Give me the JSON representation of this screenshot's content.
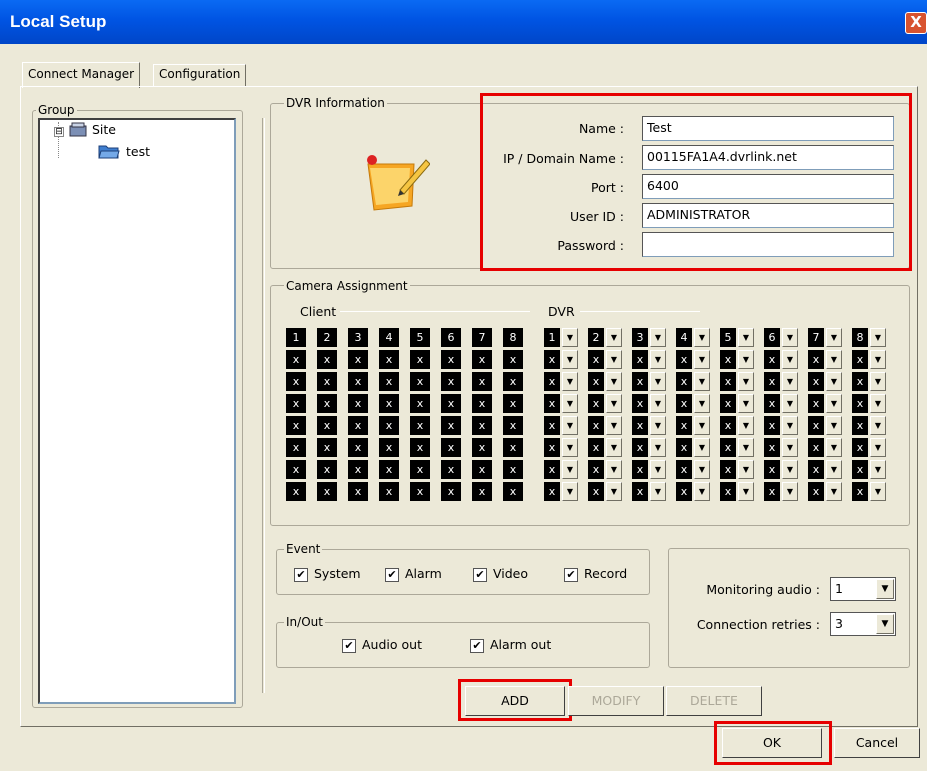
{
  "window": {
    "title": "Local Setup",
    "close_glyph": "X"
  },
  "tabs": [
    {
      "label": "Connect Manager"
    },
    {
      "label": "Configuration"
    }
  ],
  "group": {
    "label": "Group",
    "tree": [
      {
        "label": "Site",
        "expander": "⊟",
        "icon": "folder-icon"
      },
      {
        "label": "test",
        "icon": "folder-icon"
      }
    ]
  },
  "dvr_info": {
    "label": "DVR Information",
    "fields": [
      {
        "label": "Name :",
        "value": "Test"
      },
      {
        "label": "IP / Domain Name :",
        "value": "00115FA1A4.dvrlink.net"
      },
      {
        "label": "Port :",
        "value": "6400"
      },
      {
        "label": "User ID :",
        "value": "ADMINISTRATOR"
      },
      {
        "label": "Password :",
        "value": ""
      }
    ]
  },
  "camera": {
    "label": "Camera Assignment",
    "client_label": "Client",
    "dvr_label": "DVR",
    "headers": [
      "1",
      "2",
      "3",
      "4",
      "5",
      "6",
      "7",
      "8"
    ],
    "cell_mark": "x",
    "row_count": 7
  },
  "event": {
    "label": "Event",
    "items": [
      {
        "label": "System",
        "checked": true
      },
      {
        "label": "Alarm",
        "checked": true
      },
      {
        "label": "Video",
        "checked": true
      },
      {
        "label": "Record",
        "checked": true
      }
    ]
  },
  "inout": {
    "label": "In/Out",
    "items": [
      {
        "label": "Audio out",
        "checked": true
      },
      {
        "label": "Alarm out",
        "checked": true
      }
    ]
  },
  "monitoring": {
    "audio_label": "Monitoring audio :",
    "audio_value": "1",
    "retries_label": "Connection retries :",
    "retries_value": "3"
  },
  "buttons": {
    "add": "ADD",
    "modify": "MODIFY",
    "delete": "DELETE",
    "ok": "OK",
    "cancel": "Cancel"
  },
  "highlight_color": "#E60000"
}
